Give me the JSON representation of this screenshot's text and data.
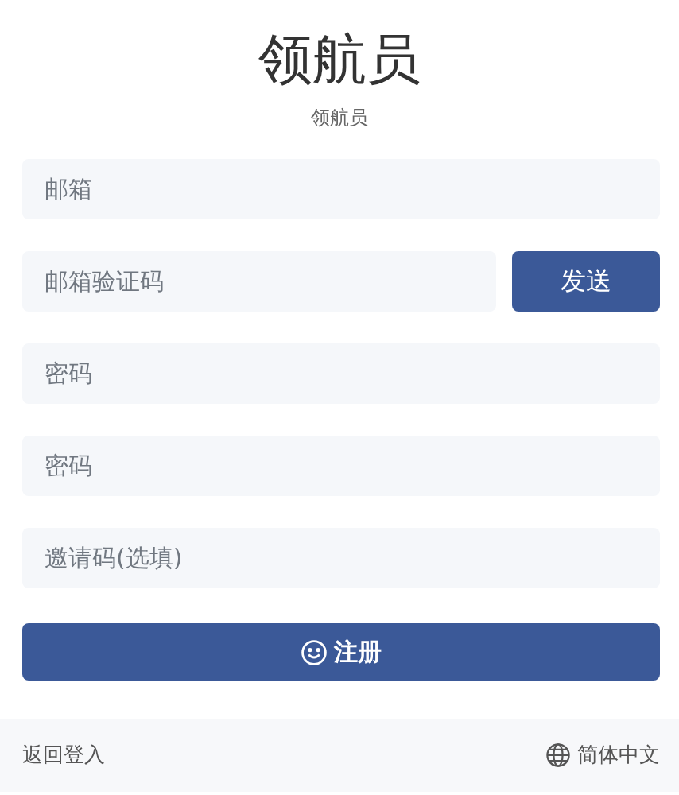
{
  "header": {
    "title": "领航员",
    "subtitle": "领航员"
  },
  "fields": [
    {
      "placeholder": "邮箱",
      "kind": "text"
    },
    {
      "placeholder": "邮箱验证码",
      "kind": "code",
      "button": "发送"
    },
    {
      "placeholder": "密码",
      "kind": "password"
    },
    {
      "placeholder": "密码",
      "kind": "password"
    },
    {
      "placeholder": "邀请码(选填)",
      "kind": "text"
    }
  ],
  "submit": {
    "label": "注册"
  },
  "footer": {
    "back_link": "返回登入",
    "language": "简体中文"
  }
}
